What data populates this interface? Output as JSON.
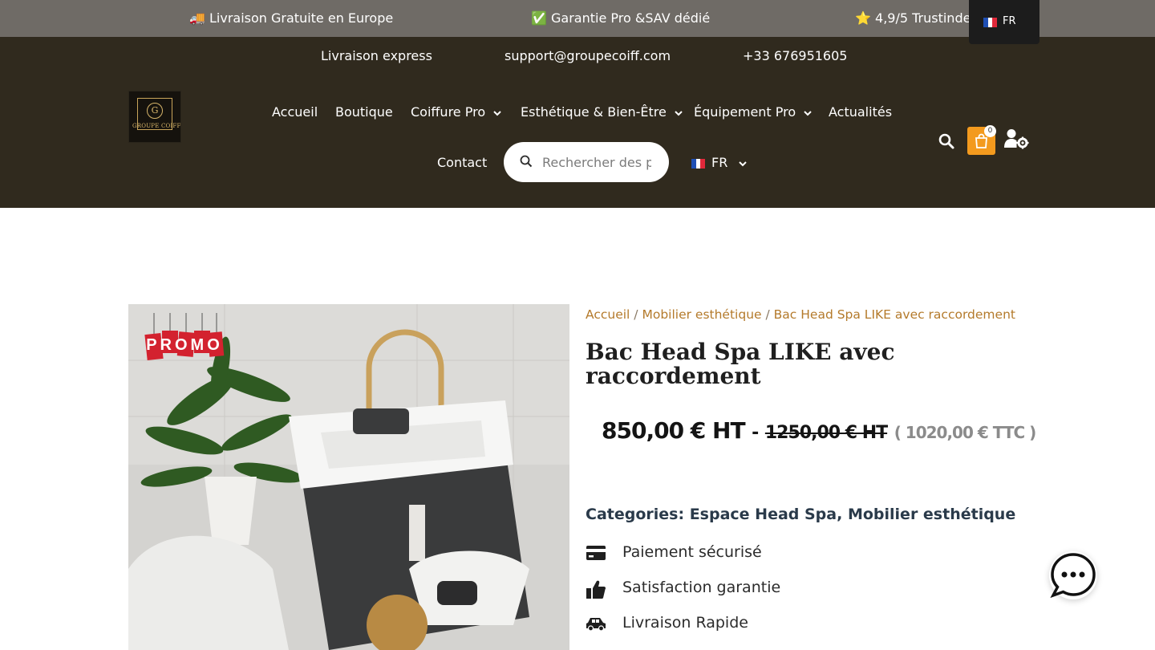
{
  "topbar": {
    "announcements": [
      "🚚 Livraison Gratuite en Europe",
      "✅ Garantie Pro &SAV dédié",
      "⭐ 4,9/5 Trustindex"
    ],
    "lang_switch": {
      "code": "FR"
    }
  },
  "header": {
    "contact": {
      "delivery": "Livraison express",
      "email": "support@groupecoiff.com",
      "phone": "+33 676951605"
    },
    "logo": {
      "mark": "G",
      "text": "GROUPE COIFF"
    },
    "nav": {
      "home": "Accueil",
      "shop": "Boutique",
      "hair": "Coiffure Pro",
      "aesthetic": "Esthétique & Bien-Être",
      "equipment": "Équipement Pro",
      "news": "Actualités",
      "contact": "Contact"
    },
    "search": {
      "placeholder": "Rechercher des produits"
    },
    "language": {
      "code": "FR"
    },
    "cart": {
      "count": "0"
    }
  },
  "product": {
    "promo_label": "PROMO",
    "breadcrumb": {
      "home": "Accueil",
      "category": "Mobilier esthétique",
      "current": "Bac Head Spa LIKE avec raccordement",
      "separator": "/"
    },
    "title": "Bac Head Spa LIKE avec raccordement",
    "price": {
      "current": "850,00 € HT",
      "dash": "-",
      "old": "1250,00 € HT",
      "ttc": "( 1020,00 € TTC )"
    },
    "categories": {
      "label": "Categories:",
      "items": [
        "Espace Head Spa",
        "Mobilier esthétique"
      ],
      "separator": ","
    },
    "features": [
      {
        "icon": "credit-card-icon",
        "text": "Paiement sécurisé"
      },
      {
        "icon": "thumbs-up-icon",
        "text": "Satisfaction garantie"
      },
      {
        "icon": "truck-icon",
        "text": "Livraison Rapide"
      }
    ]
  },
  "colors": {
    "header_bg": "#302a1e",
    "topbar_bg": "#6f6b66",
    "accent": "#f39a1e",
    "breadcrumb": "#b47a2b"
  }
}
